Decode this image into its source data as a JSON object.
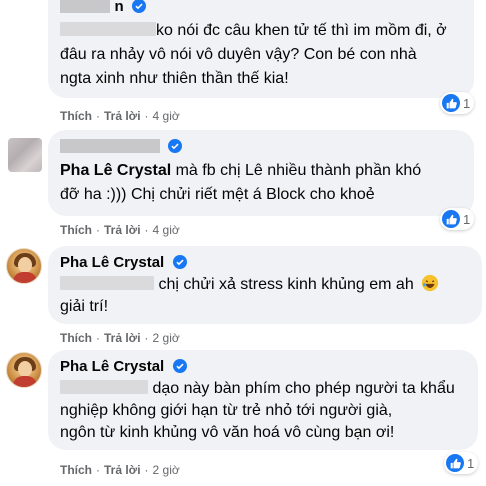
{
  "comments": [
    {
      "author": "",
      "text": "ko nói đc câu khen tử tế thì im mồm đi, ở đâu ra nhảy vô nói vô duyên vậy? Con bé con nhà ngta xinh như thiên thần thế kia!",
      "text_line1": "ko nói đc câu khen tử tế thì im mồm đi, ở",
      "text_line2": "đâu ra nhảy vô nói vô duyên vậy? Con bé con nhà",
      "text_line3": "ngta xinh như thiên thần thế kia!",
      "like_label": "Thích",
      "reply_label": "Trả lời",
      "time": "4 giờ",
      "reaction_count": "1"
    },
    {
      "author": "",
      "text_line1_name": "Pha Lê Crystal",
      "text_line1_rest": " mà fb chị Lê nhiều thành phần khó",
      "text_line2": "đỡ ha :))) Chị chửi riết mệt á Block cho khoẻ",
      "like_label": "Thích",
      "reply_label": "Trả lời",
      "time": "4 giờ",
      "reaction_count": "1"
    },
    {
      "author": "Pha Lê Crystal",
      "text_line1": " chị chửi xả stress kinh khủng em ah",
      "text_line2": "giải trí!",
      "like_label": "Thích",
      "reply_label": "Trả lời",
      "time": "2 giờ"
    },
    {
      "author": "Pha Lê Crystal",
      "text_line1": " dạo này bàn phím cho phép người ta khẩu",
      "text_line2": "nghiệp không giới hạn từ trẻ nhỏ tới người già,",
      "text_line3": "ngôn từ kinh khủng vô văn hoá vô cùng bạn ơi!",
      "like_label": "Thích",
      "reply_label": "Trả lời",
      "time": "2 giờ",
      "reaction_count": "1"
    }
  ],
  "icons": {
    "verified": "verified-badge-icon",
    "like": "like-thumb-icon",
    "emoji": "laughing-emoji-icon"
  },
  "colors": {
    "bubble_bg": "#f0f2f5",
    "meta_text": "#65676b",
    "like_blue": "#1877f2"
  }
}
